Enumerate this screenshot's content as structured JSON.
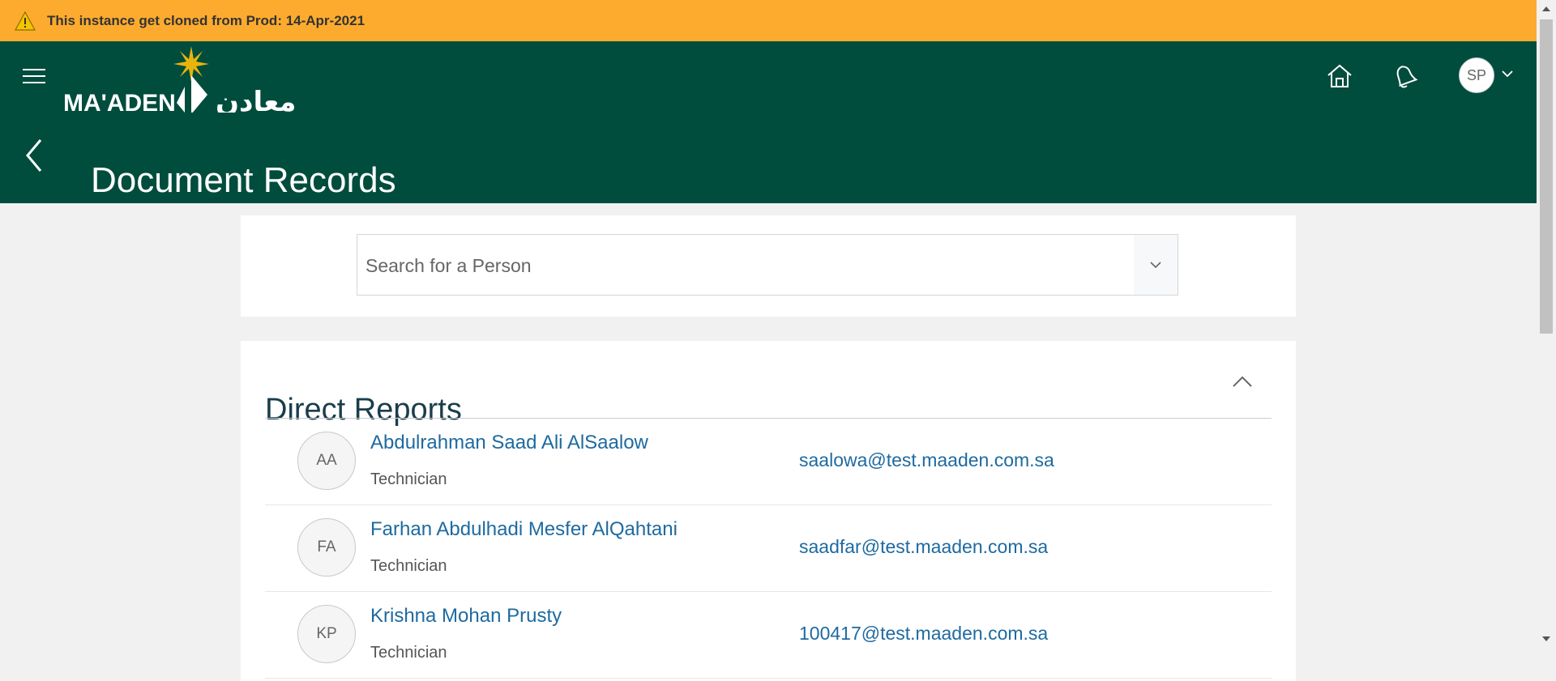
{
  "banner": {
    "icon": "warning-icon",
    "text": "This instance get cloned from Prod: 14-Apr-2021",
    "color": "#fdab2e"
  },
  "header": {
    "color": "#004d3d",
    "logo_text": "MA'ADEN",
    "logo_arabic": "معادن",
    "avatar_initials": "SP",
    "title": "Document Records"
  },
  "search": {
    "placeholder": "Search for a Person"
  },
  "direct_reports": {
    "title": "Direct Reports",
    "people": [
      {
        "initials": "AA",
        "name": "Abdulrahman Saad Ali AlSaalow",
        "role": "Technician",
        "email": "saalowa@test.maaden.com.sa"
      },
      {
        "initials": "FA",
        "name": "Farhan Abdulhadi Mesfer AlQahtani",
        "role": "Technician",
        "email": "saadfar@test.maaden.com.sa"
      },
      {
        "initials": "KP",
        "name": "Krishna Mohan Prusty",
        "role": "Technician",
        "email": "100417@test.maaden.com.sa"
      }
    ]
  }
}
